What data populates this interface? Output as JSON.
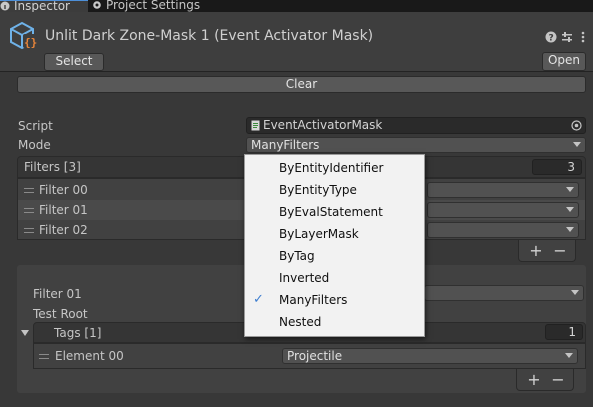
{
  "tabs": [
    {
      "label": "Inspector",
      "icon": "info-icon"
    },
    {
      "label": "Project Settings",
      "icon": "gear-icon"
    }
  ],
  "header": {
    "title": "Unlit Dark Zone-Mask 1 (Event Activator Mask)",
    "select_label": "Select",
    "open_label": "Open"
  },
  "clear_label": "Clear",
  "script": {
    "label": "Script",
    "value": "EventActivatorMask"
  },
  "mode": {
    "label": "Mode",
    "value": "ManyFilters"
  },
  "filters": {
    "label": "Filters [3]",
    "count": "3",
    "items": [
      {
        "label": "Filter 00"
      },
      {
        "label": "Filter 01"
      },
      {
        "label": "Filter 02"
      }
    ]
  },
  "filter_detail": {
    "label": "Filter 01",
    "test_root_label": "Test Root",
    "tags": {
      "label": "Tags [1]",
      "count": "1",
      "element_label": "Element 00",
      "element_value": "Projectile"
    }
  },
  "list_controls": {
    "add": "+",
    "remove": "−"
  },
  "mode_menu": {
    "options": [
      "ByEntityIdentifier",
      "ByEntityType",
      "ByEvalStatement",
      "ByLayerMask",
      "ByTag",
      "Inverted",
      "ManyFilters",
      "Nested"
    ],
    "selected": "ManyFilters",
    "check_glyph": "✓"
  }
}
